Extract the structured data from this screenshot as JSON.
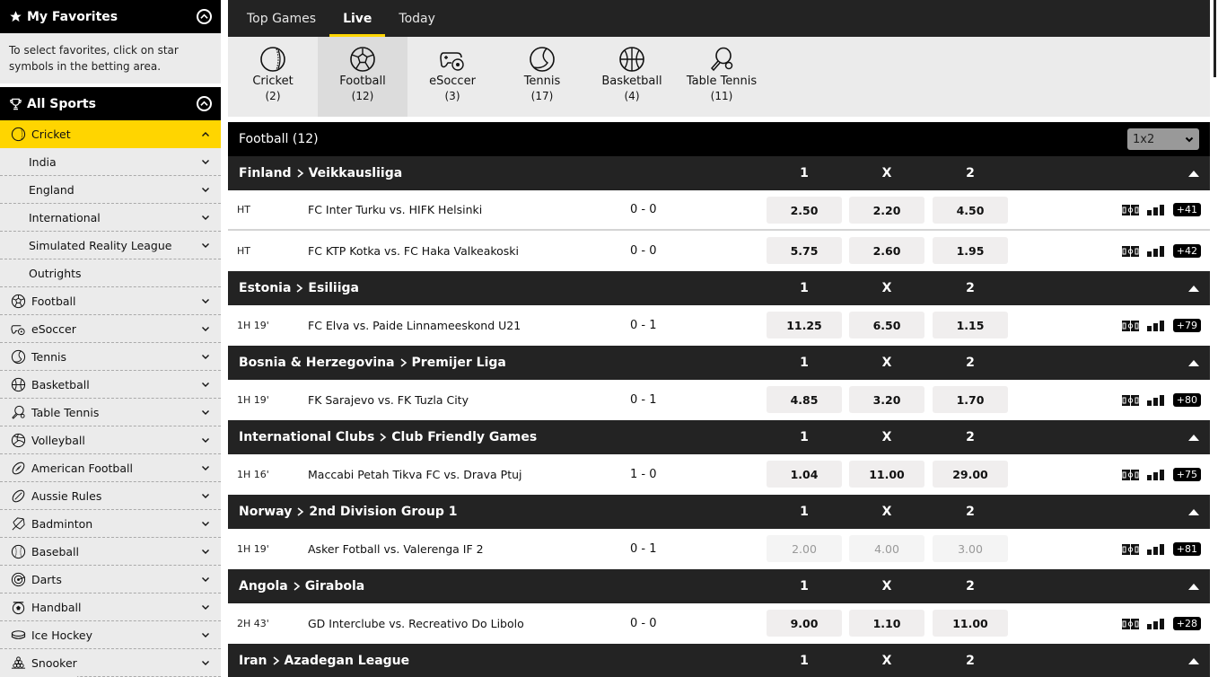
{
  "sidebar": {
    "favorites": {
      "title": "My Favorites",
      "icon": "star-icon",
      "hint": "To select favorites, click on star symbols in the betting area."
    },
    "all_sports": {
      "title": "All Sports",
      "icon": "trophy-icon"
    },
    "items": [
      {
        "label": "Cricket",
        "icon": "cricket-icon",
        "active": true
      },
      {
        "label": "India",
        "sub": true
      },
      {
        "label": "England",
        "sub": true
      },
      {
        "label": "International",
        "sub": true
      },
      {
        "label": "Simulated Reality League",
        "sub": true
      },
      {
        "label": "Outrights",
        "sub": true
      },
      {
        "label": "Football",
        "icon": "football-icon"
      },
      {
        "label": "eSoccer",
        "icon": "esoccer-icon"
      },
      {
        "label": "Tennis",
        "icon": "tennis-icon"
      },
      {
        "label": "Basketball",
        "icon": "basketball-icon"
      },
      {
        "label": "Table Tennis",
        "icon": "table-tennis-icon"
      },
      {
        "label": "Volleyball",
        "icon": "volleyball-icon"
      },
      {
        "label": "American Football",
        "icon": "american-football-icon"
      },
      {
        "label": "Aussie Rules",
        "icon": "aussie-rules-icon"
      },
      {
        "label": "Badminton",
        "icon": "badminton-icon"
      },
      {
        "label": "Baseball",
        "icon": "baseball-icon"
      },
      {
        "label": "Darts",
        "icon": "darts-icon"
      },
      {
        "label": "Handball",
        "icon": "handball-icon"
      },
      {
        "label": "Ice Hockey",
        "icon": "ice-hockey-icon"
      },
      {
        "label": "Snooker",
        "icon": "snooker-icon"
      }
    ]
  },
  "tabs": [
    {
      "label": "Top Games"
    },
    {
      "label": "Live",
      "active": true
    },
    {
      "label": "Today"
    }
  ],
  "sport_tabs": [
    {
      "label": "Cricket",
      "count": "(2)"
    },
    {
      "label": "Football",
      "count": "(12)",
      "active": true
    },
    {
      "label": "eSoccer",
      "count": "(3)"
    },
    {
      "label": "Tennis",
      "count": "(17)"
    },
    {
      "label": "Basketball",
      "count": "(4)"
    },
    {
      "label": "Table Tennis",
      "count": "(11)"
    }
  ],
  "section": {
    "title": "Football (12)",
    "market_select": "1x2"
  },
  "column_headers": {
    "home": "1",
    "draw": "X",
    "away": "2"
  },
  "leagues": [
    {
      "country": "Finland",
      "league": "Veikkausliiga",
      "matches": [
        {
          "time": "HT",
          "teams": "FC Inter Turku vs. HIFK Helsinki",
          "score": "0 - 0",
          "odds": [
            "2.50",
            "2.20",
            "4.50"
          ],
          "more": "+41"
        },
        {
          "time": "HT",
          "teams": "FC KTP Kotka vs. FC Haka Valkeakoski",
          "score": "0 - 0",
          "odds": [
            "5.75",
            "2.60",
            "1.95"
          ],
          "more": "+42"
        }
      ]
    },
    {
      "country": "Estonia",
      "league": "Esiliiga",
      "matches": [
        {
          "time": "1H 19'",
          "teams": "FC Elva vs. Paide Linnameeskond U21",
          "score": "0 - 1",
          "odds": [
            "11.25",
            "6.50",
            "1.15"
          ],
          "more": "+79"
        }
      ]
    },
    {
      "country": "Bosnia & Herzegovina",
      "league": "Premijer Liga",
      "matches": [
        {
          "time": "1H 19'",
          "teams": "FK Sarajevo vs. FK Tuzla City",
          "score": "0 - 1",
          "odds": [
            "4.85",
            "3.20",
            "1.70"
          ],
          "more": "+80"
        }
      ]
    },
    {
      "country": "International Clubs",
      "league": "Club Friendly Games",
      "matches": [
        {
          "time": "1H 16'",
          "teams": "Maccabi Petah Tikva FC vs. Drava Ptuj",
          "score": "1 - 0",
          "odds": [
            "1.04",
            "11.00",
            "29.00"
          ],
          "more": "+75"
        }
      ]
    },
    {
      "country": "Norway",
      "league": "2nd Division Group 1",
      "matches": [
        {
          "time": "1H 19'",
          "teams": "Asker Fotball vs. Valerenga IF 2",
          "score": "0 - 1",
          "odds": [
            "2.00",
            "4.00",
            "3.00"
          ],
          "more": "+81",
          "suspended": true
        }
      ]
    },
    {
      "country": "Angola",
      "league": "Girabola",
      "matches": [
        {
          "time": "2H 43'",
          "teams": "GD Interclube vs. Recreativo Do Libolo",
          "score": "0 - 0",
          "odds": [
            "9.00",
            "1.10",
            "11.00"
          ],
          "more": "+28"
        }
      ]
    },
    {
      "country": "Iran",
      "league": "Azadegan League",
      "matches": []
    }
  ],
  "colors": {
    "accent": "#ffd500",
    "header_bg": "#000000",
    "league_bg": "#232323",
    "odds_bg": "#f0eeee"
  }
}
